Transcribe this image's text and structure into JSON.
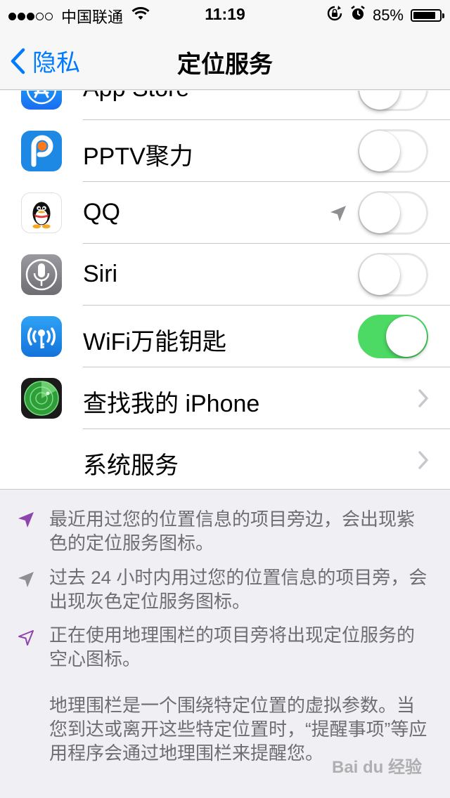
{
  "status_bar": {
    "carrier": "中国联通",
    "time": "11:19",
    "battery": "85%",
    "battery_level": 0.85,
    "signal_dots": 5,
    "signal_filled": 3
  },
  "nav": {
    "back_label": "隐私",
    "title": "定位服务"
  },
  "rows": [
    {
      "label": "App Store",
      "control": "toggle",
      "on": false
    },
    {
      "label": "PPTV聚力",
      "control": "toggle",
      "on": false
    },
    {
      "label": "QQ",
      "control": "toggle",
      "on": false,
      "location_arrow": "gray"
    },
    {
      "label": "Siri",
      "control": "toggle",
      "on": false
    },
    {
      "label": "WiFi万能钥匙",
      "control": "toggle",
      "on": true
    },
    {
      "label": "查找我的 iPhone",
      "control": "chevron"
    },
    {
      "label": "系统服务",
      "control": "chevron"
    }
  ],
  "footer": {
    "note_purple": "最近用过您的位置信息的项目旁边，会出现紫色的定位服务图标。",
    "note_gray": "过去 24 小时内用过您的位置信息的项目旁，会出现灰色定位服务图标。",
    "note_hollow": "正在使用地理围栏的项目旁将出现定位服务的空心图标。",
    "note_geofence": "地理围栏是一个围绕特定位置的虚拟参数。当您到达或离开这些特定位置时，“提醒事项”等应用程序会通过地理围栏来提醒您。"
  },
  "watermark": "Bai du 经验",
  "colors": {
    "accent": "#007aff",
    "toggle_on": "#4cd964",
    "location_purple": "#8e44ad",
    "location_gray": "#8e8e93"
  }
}
